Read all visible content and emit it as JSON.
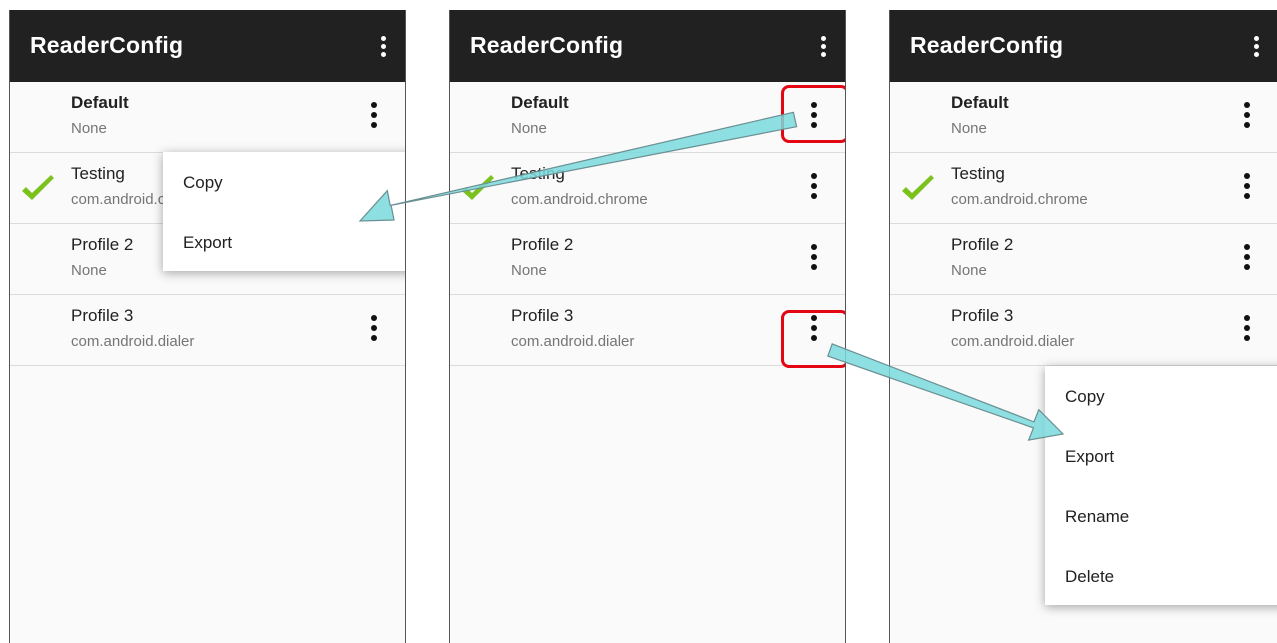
{
  "app_title": "ReaderConfig",
  "icons": {
    "overflow": "more-vert-icon",
    "active": "green-check-icon"
  },
  "colors": {
    "appbar": "#212121",
    "highlight": "#e30613",
    "arrow": "#7ad9dd",
    "check": "#7cc21e"
  },
  "profiles": [
    {
      "name": "Default",
      "sub": "None",
      "active": false
    },
    {
      "name": "Testing",
      "sub": "com.android.chrome",
      "active": true
    },
    {
      "name": "Profile 2",
      "sub": "None",
      "active": false
    },
    {
      "name": "Profile 3",
      "sub": "com.android.dialer",
      "active": false
    }
  ],
  "left_menu": [
    "Copy",
    "Export"
  ],
  "right_menu": [
    "Copy",
    "Export",
    "Rename",
    "Delete"
  ]
}
